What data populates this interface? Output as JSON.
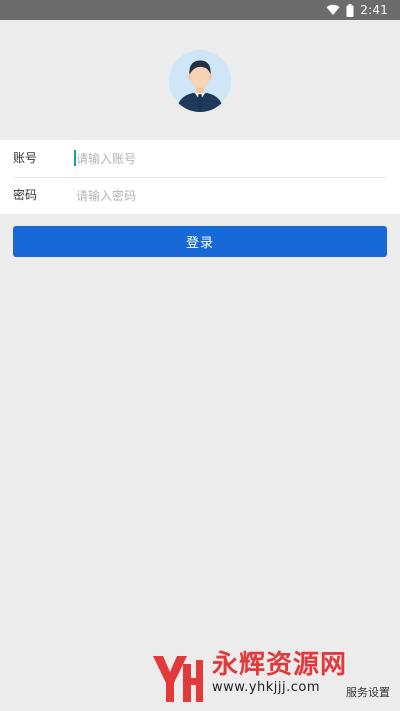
{
  "status_bar": {
    "time": "2:41",
    "icons": [
      "wifi-icon",
      "battery-icon"
    ]
  },
  "avatar": {
    "icon": "user-avatar-icon"
  },
  "form": {
    "account_label": "账号",
    "account_placeholder": "请输入账号",
    "account_value": "",
    "password_label": "密码",
    "password_placeholder": "请输入密码",
    "password_value": ""
  },
  "login_button": {
    "label": "登录"
  },
  "footer": {
    "server_settings_label": "服务设置"
  },
  "watermark": {
    "logo_letters": "YH",
    "name": "永辉资源网",
    "url": "www.yhkjjj.com"
  },
  "colors": {
    "status_bar": "#6c6c6c",
    "background": "#ececec",
    "primary": "#1769d8",
    "watermark_red": "#e23a3a"
  }
}
